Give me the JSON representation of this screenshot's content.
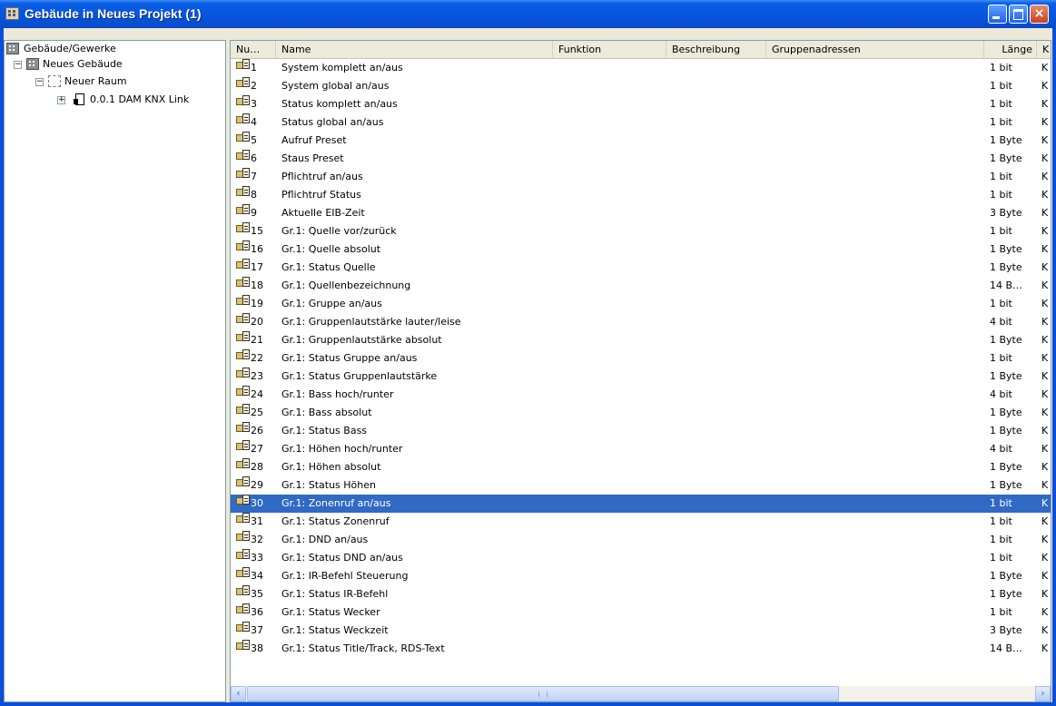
{
  "window": {
    "title": "Gebäude in Neues Projekt (1)",
    "close_glyph": "×"
  },
  "tree": {
    "items": [
      {
        "label": "Gebäude/Gewerke",
        "icon": "buildings-icon"
      },
      {
        "label": "Neues Gebäude",
        "icon": "building-icon",
        "expander": "−"
      },
      {
        "label": "Neuer Raum",
        "icon": "room-icon",
        "expander": "−"
      },
      {
        "label": "0.0.1 DAM KNX Link",
        "icon": "device-icon",
        "expander": "+"
      }
    ]
  },
  "list": {
    "columns": [
      "Nu…",
      "Name",
      "Funktion",
      "Beschreibung",
      "Gruppenadressen",
      "Länge",
      "K"
    ],
    "rows": [
      {
        "num": "1",
        "name": "System komplett an/aus",
        "len": "1 bit",
        "k": "K"
      },
      {
        "num": "2",
        "name": "System global an/aus",
        "len": "1 bit",
        "k": "K"
      },
      {
        "num": "3",
        "name": "Status komplett an/aus",
        "len": "1 bit",
        "k": "K"
      },
      {
        "num": "4",
        "name": "Status global an/aus",
        "len": "1 bit",
        "k": "K"
      },
      {
        "num": "5",
        "name": "Aufruf Preset",
        "len": "1 Byte",
        "k": "K"
      },
      {
        "num": "6",
        "name": "Staus Preset",
        "len": "1 Byte",
        "k": "K"
      },
      {
        "num": "7",
        "name": "Pflichtruf an/aus",
        "len": "1 bit",
        "k": "K"
      },
      {
        "num": "8",
        "name": "Pflichtruf Status",
        "len": "1 bit",
        "k": "K"
      },
      {
        "num": "9",
        "name": "Aktuelle EIB-Zeit",
        "len": "3 Byte",
        "k": "K"
      },
      {
        "num": "15",
        "name": "Gr.1: Quelle vor/zurück",
        "len": "1 bit",
        "k": "K"
      },
      {
        "num": "16",
        "name": "Gr.1: Quelle absolut",
        "len": "1 Byte",
        "k": "K"
      },
      {
        "num": "17",
        "name": "Gr.1: Status Quelle",
        "len": "1 Byte",
        "k": "K"
      },
      {
        "num": "18",
        "name": "Gr.1: Quellenbezeichnung",
        "len": "14 B…",
        "k": "K"
      },
      {
        "num": "19",
        "name": "Gr.1: Gruppe an/aus",
        "len": "1 bit",
        "k": "K"
      },
      {
        "num": "20",
        "name": "Gr.1: Gruppenlautstärke lauter/leise",
        "len": "4 bit",
        "k": "K"
      },
      {
        "num": "21",
        "name": "Gr.1: Gruppenlautstärke absolut",
        "len": "1 Byte",
        "k": "K"
      },
      {
        "num": "22",
        "name": "Gr.1: Status Gruppe an/aus",
        "len": "1 bit",
        "k": "K"
      },
      {
        "num": "23",
        "name": "Gr.1: Status Gruppenlautstärke",
        "len": "1 Byte",
        "k": "K"
      },
      {
        "num": "24",
        "name": "Gr.1: Bass hoch/runter",
        "len": "4 bit",
        "k": "K"
      },
      {
        "num": "25",
        "name": "Gr.1: Bass absolut",
        "len": "1 Byte",
        "k": "K"
      },
      {
        "num": "26",
        "name": "Gr.1: Status Bass",
        "len": "1 Byte",
        "k": "K"
      },
      {
        "num": "27",
        "name": "Gr.1: Höhen hoch/runter",
        "len": "4 bit",
        "k": "K"
      },
      {
        "num": "28",
        "name": "Gr.1: Höhen absolut",
        "len": "1 Byte",
        "k": "K"
      },
      {
        "num": "29",
        "name": "Gr.1: Status Höhen",
        "len": "1 Byte",
        "k": "K"
      },
      {
        "num": "30",
        "name": "Gr.1: Zonenruf an/aus",
        "len": "1 bit",
        "k": "K",
        "selected": true
      },
      {
        "num": "31",
        "name": "Gr.1: Status Zonenruf",
        "len": "1 bit",
        "k": "K"
      },
      {
        "num": "32",
        "name": "Gr.1: DND an/aus",
        "len": "1 bit",
        "k": "K"
      },
      {
        "num": "33",
        "name": "Gr.1: Status DND an/aus",
        "len": "1 bit",
        "k": "K"
      },
      {
        "num": "34",
        "name": "Gr.1: IR-Befehl Steuerung",
        "len": "1 Byte",
        "k": "K"
      },
      {
        "num": "35",
        "name": "Gr.1: Status IR-Befehl",
        "len": "1 Byte",
        "k": "K"
      },
      {
        "num": "36",
        "name": "Gr.1: Status Wecker",
        "len": "1 bit",
        "k": "K"
      },
      {
        "num": "37",
        "name": "Gr.1: Status Weckzeit",
        "len": "3 Byte",
        "k": "K"
      },
      {
        "num": "38",
        "name": "Gr.1: Status Title/Track, RDS-Text",
        "len": "14 B…",
        "k": "K"
      }
    ]
  },
  "scrollbar": {
    "left_glyph": "‹",
    "right_glyph": "›"
  },
  "colors": {
    "titlebar": "#0756dd",
    "selection": "#316ac5"
  }
}
